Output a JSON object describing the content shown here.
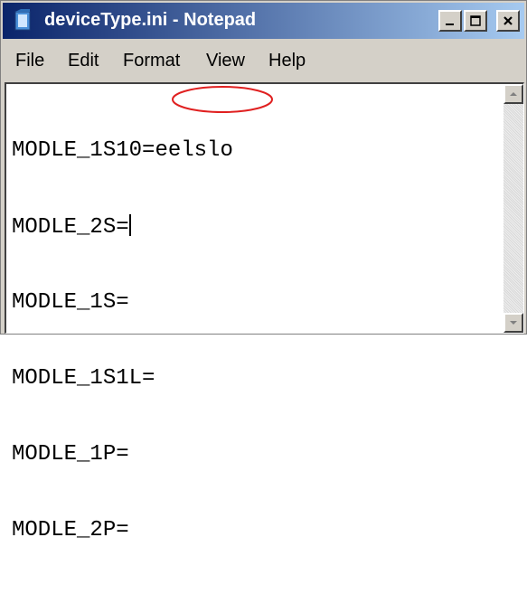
{
  "window": {
    "title": "deviceType.ini - Notepad"
  },
  "menu": {
    "file": "File",
    "edit": "Edit",
    "format": "Format",
    "view": "View",
    "help": "Help"
  },
  "editor": {
    "lines": [
      {
        "key": "MODLE_1S10=",
        "value": "eelslo"
      },
      {
        "key": "MODLE_2S=",
        "value": ""
      },
      {
        "key": "MODLE_1S=",
        "value": ""
      },
      {
        "key": "MODLE_1S1L=",
        "value": ""
      },
      {
        "key": "MODLE_1P=",
        "value": ""
      },
      {
        "key": "MODLE_2P=",
        "value": ""
      }
    ]
  },
  "icons": {
    "app": "notepad-icon",
    "minimize": "minimize-icon",
    "maximize": "maximize-icon",
    "close": "close-icon",
    "scroll_up": "arrow-up-icon",
    "scroll_down": "arrow-down-icon"
  },
  "colors": {
    "titlebar_start": "#0a246a",
    "titlebar_end": "#a6caf0",
    "annotation": "#e02020"
  }
}
